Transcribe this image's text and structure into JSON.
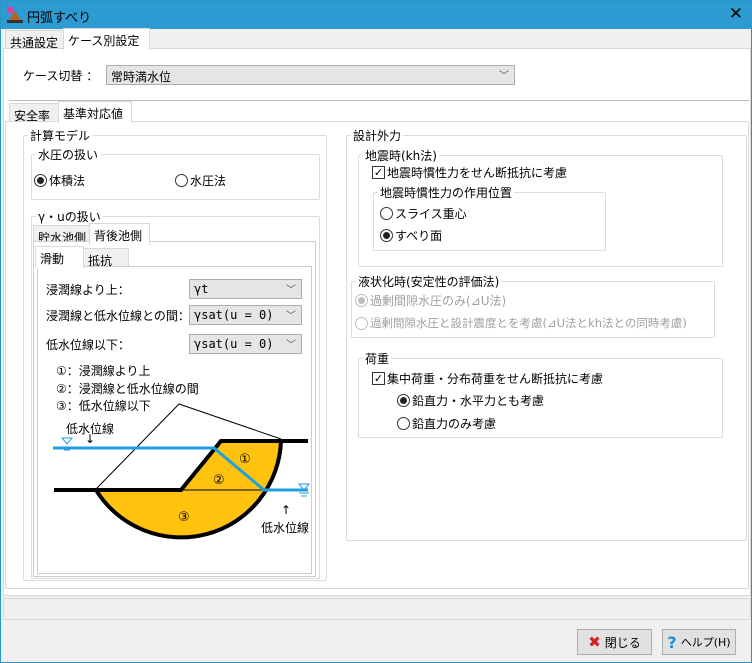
{
  "window": {
    "title": "円弧すべり",
    "close_icon": "close-icon"
  },
  "outer_tabs": [
    "共通設定",
    "ケース別設定"
  ],
  "case": {
    "label": "ケース切替 ：",
    "value": "常時満水位"
  },
  "inner_tabs": [
    "安全率",
    "基準対応値"
  ],
  "model": {
    "title": "計算モデル",
    "water": {
      "title": "水圧の扱い",
      "options": [
        "体積法",
        "水圧法"
      ],
      "selected": 0
    },
    "gu": {
      "title": "γ・uの扱い",
      "tabs": [
        "貯水池側",
        "背後池側"
      ],
      "subtabs": [
        "滑動",
        "抵抗"
      ],
      "rows": [
        {
          "label": "浸潤線より上：",
          "value": "γt"
        },
        {
          "label": "浸潤線と低水位線との間：",
          "value": "γsat(u = 0)"
        },
        {
          "label": "低水位線以下：",
          "value": "γsat(u = 0)"
        }
      ],
      "legend": [
        "①：浸潤線より上",
        "②：浸潤線と低水位線の間",
        "③：低水位線以下"
      ],
      "diagram": {
        "left_label": "低水位線",
        "right_label": "低水位線",
        "regions": [
          "①",
          "②",
          "③"
        ],
        "fill": "#ffc20e",
        "water": "#1ea0e0"
      }
    }
  },
  "design": {
    "title": "設計外力",
    "eq": {
      "title": "地震時(kh法)",
      "check": "地震時慣性力をせん断抵抗に考慮",
      "checked": true,
      "pos": {
        "title": "地震時慣性力の作用位置",
        "options": [
          "スライス重心",
          "すべり面"
        ],
        "selected": 1
      }
    },
    "liq": {
      "title": "液状化時(安定性の評価法)",
      "options": [
        "過剰間隙水圧のみ(⊿U法)",
        "過剰間隙水圧と設計震度とを考慮(⊿U法とkh法との同時考慮)"
      ],
      "selected": 0
    },
    "load": {
      "title": "荷重",
      "check": "集中荷重・分布荷重をせん断抵抗に考慮",
      "checked": true,
      "options": [
        "鉛直力・水平力とも考慮",
        "鉛直力のみ考慮"
      ],
      "selected": 0
    }
  },
  "buttons": {
    "close": "閉じる",
    "help": "ヘルプ(H)"
  }
}
